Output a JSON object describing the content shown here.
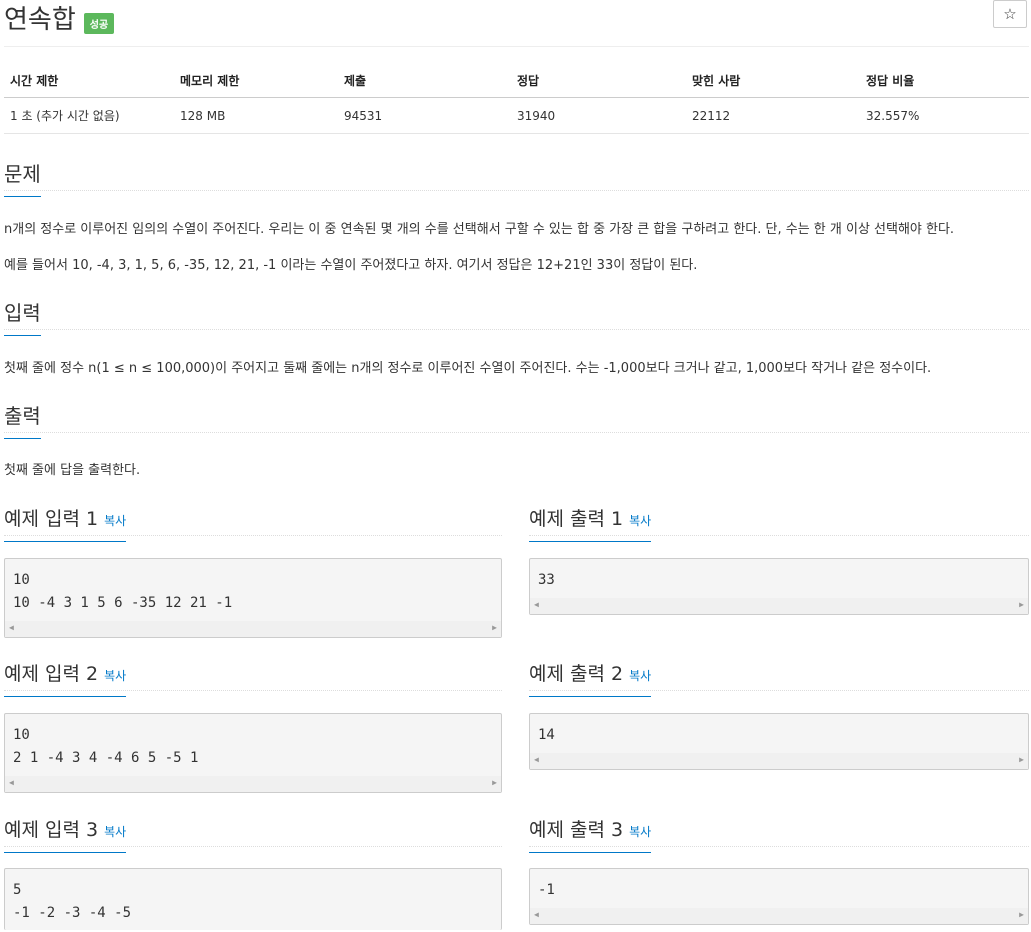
{
  "problem": {
    "title": "연속합",
    "status_badge": "성공",
    "star_icon": "☆"
  },
  "stats": {
    "headers": [
      "시간 제한",
      "메모리 제한",
      "제출",
      "정답",
      "맞힌 사람",
      "정답 비율"
    ],
    "values": [
      "1 초 (추가 시간 없음)",
      "128 MB",
      "94531",
      "31940",
      "22112",
      "32.557%"
    ]
  },
  "sections": {
    "description": {
      "title": "문제",
      "paragraphs": [
        "n개의 정수로 이루어진 임의의 수열이 주어진다. 우리는 이 중 연속된 몇 개의 수를 선택해서 구할 수 있는 합 중 가장 큰 합을 구하려고 한다. 단, 수는 한 개 이상 선택해야 한다.",
        "예를 들어서 10, -4, 3, 1, 5, 6, -35, 12, 21, -1 이라는 수열이 주어졌다고 하자. 여기서 정답은 12+21인 33이 정답이 된다."
      ]
    },
    "input": {
      "title": "입력",
      "text": "첫째 줄에 정수 n(1 ≤ n ≤ 100,000)이 주어지고 둘째 줄에는 n개의 정수로 이루어진 수열이 주어진다. 수는 -1,000보다 크거나 같고, 1,000보다 작거나 같은 정수이다."
    },
    "output": {
      "title": "출력",
      "text": "첫째 줄에 답을 출력한다."
    }
  },
  "samples": {
    "copy_label": "복사",
    "items": [
      {
        "in_title": "예제 입력 1",
        "in_text": "10\n10 -4 3 1 5 6 -35 12 21 -1",
        "out_title": "예제 출력 1",
        "out_text": "33"
      },
      {
        "in_title": "예제 입력 2",
        "in_text": "10\n2 1 -4 3 4 -4 6 5 -5 1",
        "out_title": "예제 출력 2",
        "out_text": "14"
      },
      {
        "in_title": "예제 입력 3",
        "in_text": "5\n-1 -2 -3 -4 -5",
        "out_title": "예제 출력 3",
        "out_text": "-1"
      }
    ]
  }
}
